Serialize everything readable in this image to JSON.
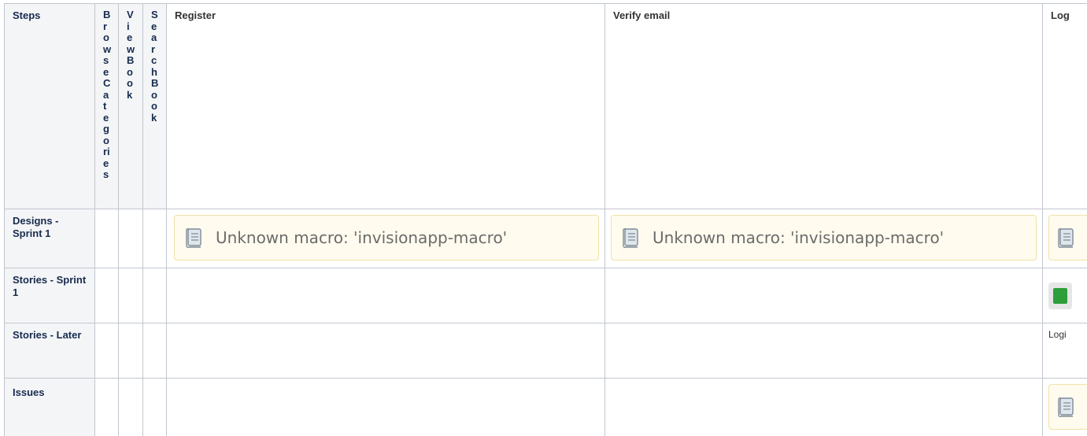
{
  "table": {
    "header": {
      "steps": "Steps",
      "browse_categories": "BrowseCategories",
      "view_book": "ViewBook",
      "search_book": "SearchBook",
      "register": "Register",
      "verify_email": "Verify email",
      "login_cut": "Log"
    },
    "rows": {
      "designs": "Designs - Sprint 1",
      "stories_sprint1": "Stories - Sprint 1",
      "stories_later": "Stories - Later",
      "issues": "Issues"
    },
    "macro_text": "Unknown macro: 'invisionapp-macro'",
    "login_cut_text": "Logi"
  },
  "icons": {
    "macro": "scroll-document-icon",
    "status": "green-status-icon"
  },
  "colors": {
    "border": "#c1c7d0",
    "header_bg": "#f4f5f7",
    "macro_bg": "#fffbee",
    "macro_border": "#f0e2a8",
    "status_green": "#2d9e3a"
  }
}
